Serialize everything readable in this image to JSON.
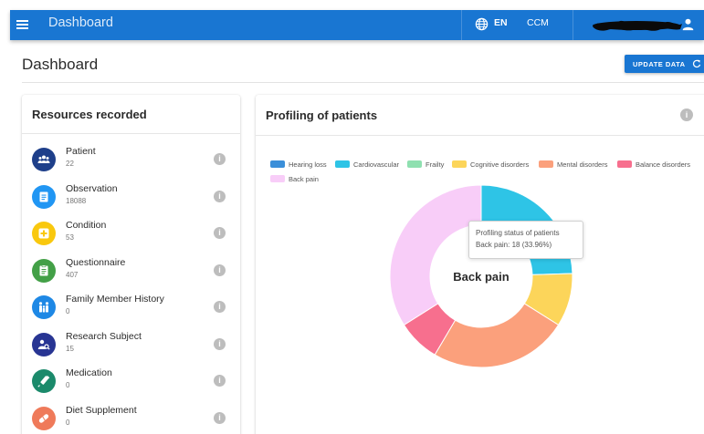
{
  "topbar": {
    "app_title": "Dashboard",
    "language": "EN",
    "organization": "CCM",
    "icons": [
      "menu-icon",
      "globe-icon",
      "user-icon"
    ],
    "accent": "#1976d2"
  },
  "page": {
    "title": "Dashboard",
    "update_button": "UPDATE DATA"
  },
  "resources": {
    "title": "Resources recorded",
    "items": [
      {
        "name": "Patient",
        "count": "22",
        "icon": "people-icon",
        "color": "#1e3f8a"
      },
      {
        "name": "Observation",
        "count": "18088",
        "icon": "clipboard-icon",
        "color": "#2196f3"
      },
      {
        "name": "Condition",
        "count": "53",
        "icon": "medical-cross-icon",
        "color": "#f9c80e"
      },
      {
        "name": "Questionnaire",
        "count": "407",
        "icon": "form-icon",
        "color": "#43a047"
      },
      {
        "name": "Family Member History",
        "count": "0",
        "icon": "family-icon",
        "color": "#1e88e5"
      },
      {
        "name": "Research Subject",
        "count": "15",
        "icon": "research-icon",
        "color": "#283593"
      },
      {
        "name": "Medication",
        "count": "0",
        "icon": "syringe-icon",
        "color": "#1b8a6b"
      },
      {
        "name": "Diet Supplement",
        "count": "0",
        "icon": "pill-icon",
        "color": "#ef7a5a"
      }
    ]
  },
  "profiling": {
    "title": "Profiling of patients",
    "center_label": "Back pain",
    "tooltip": {
      "title": "Profiling status of patients",
      "text": "Back pain: 18 (33.96%)"
    },
    "legend": [
      {
        "label": "Hearing loss",
        "color": "#3b8fd9"
      },
      {
        "label": "Cardiovascular",
        "color": "#2ec4e6"
      },
      {
        "label": "Frailty",
        "color": "#8fe0b0"
      },
      {
        "label": "Cognitive disorders",
        "color": "#fcd55a"
      },
      {
        "label": "Mental disorders",
        "color": "#fba07c"
      },
      {
        "label": "Balance disorders",
        "color": "#f76f8e"
      },
      {
        "label": "Back pain",
        "color": "#f8cdf8"
      }
    ]
  },
  "chart_data": {
    "type": "pie",
    "categories": [
      "Hearing loss",
      "Cardiovascular",
      "Frailty",
      "Cognitive disorders",
      "Mental disorders",
      "Balance disorders",
      "Back pain"
    ],
    "values": [
      0,
      13,
      0,
      5,
      13,
      4,
      18
    ],
    "colors": [
      "#3b8fd9",
      "#2ec4e6",
      "#8fe0b0",
      "#fcd55a",
      "#fba07c",
      "#f76f8e",
      "#f8cdf8"
    ],
    "donut": true,
    "legend_position": "top"
  }
}
